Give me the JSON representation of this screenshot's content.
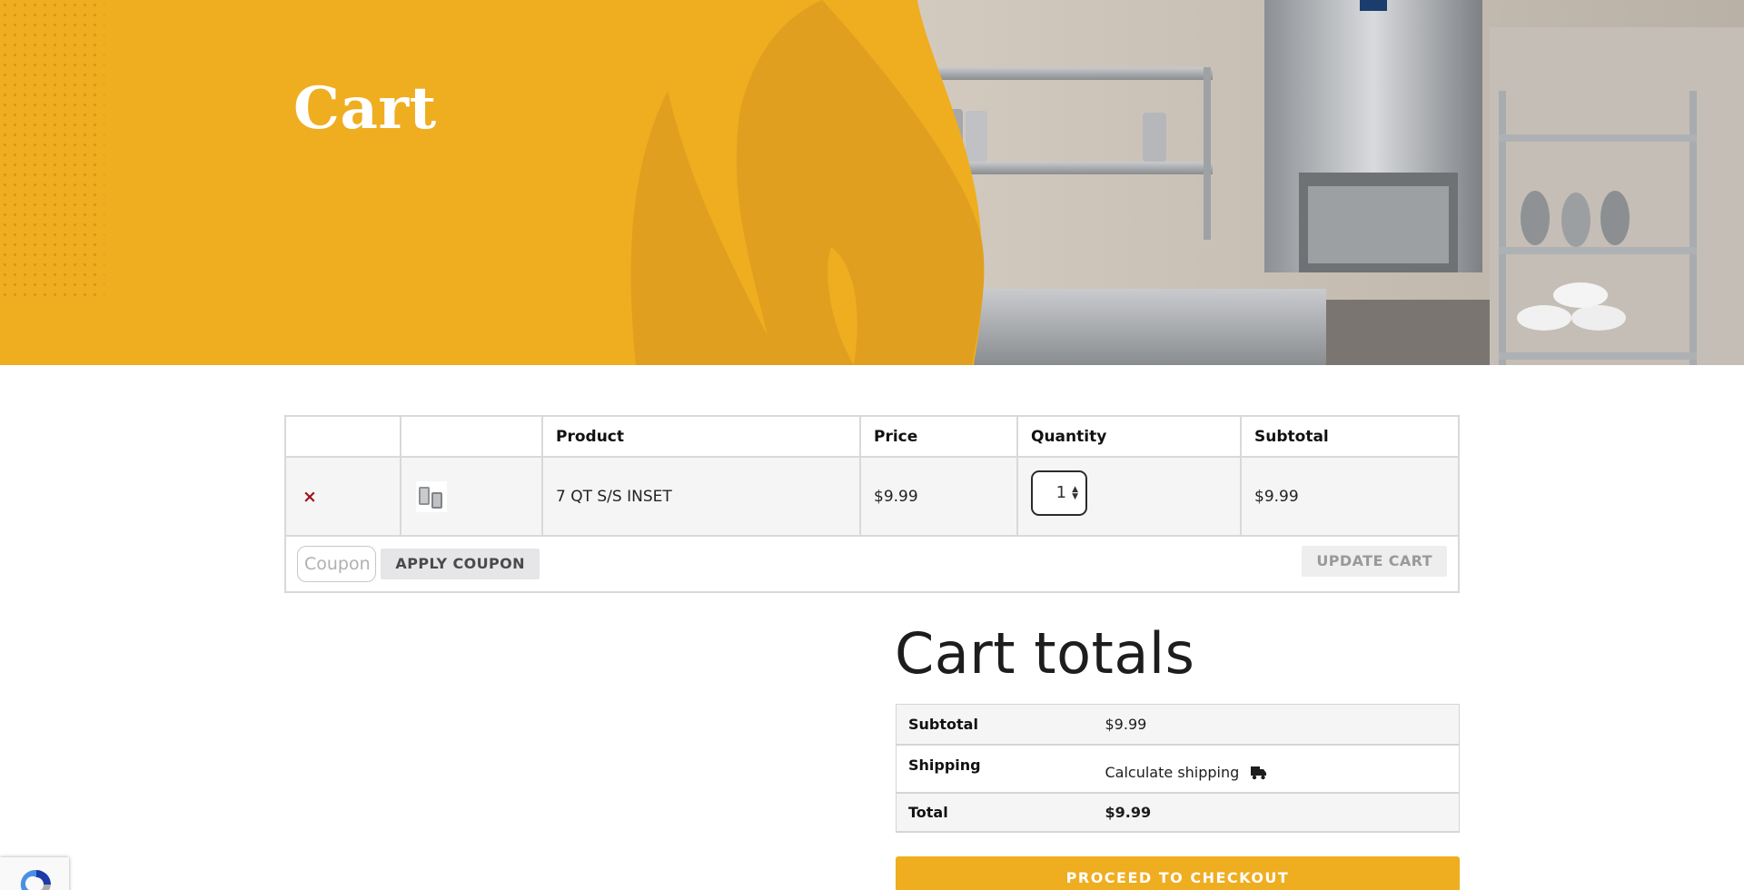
{
  "hero": {
    "title": "Cart"
  },
  "cart_table": {
    "headers": [
      "",
      "",
      "Product",
      "Price",
      "Quantity",
      "Subtotal"
    ],
    "rows": [
      {
        "remove_icon": "×",
        "thumbnail": "product-thumbnail",
        "product": "7 QT S/S INSET",
        "price": "$9.99",
        "quantity": "1",
        "subtotal": "$9.99"
      }
    ],
    "coupon_placeholder": "Coupon",
    "apply_coupon_label": "APPLY COUPON",
    "update_cart_label": "UPDATE CART"
  },
  "cart_totals": {
    "title": "Cart totals",
    "subtotal_label": "Subtotal",
    "subtotal_value": "$9.99",
    "shipping_label": "Shipping",
    "shipping_value": "Calculate shipping",
    "total_label": "Total",
    "total_value": "$9.99"
  },
  "checkout": {
    "label": "PROCEED TO CHECKOUT"
  },
  "colors": {
    "accent": "#efad20",
    "remove": "#a0121c"
  },
  "icons": [
    "remove-icon",
    "truck-icon",
    "spinner-up-icon",
    "spinner-down-icon",
    "recaptcha-icon"
  ]
}
